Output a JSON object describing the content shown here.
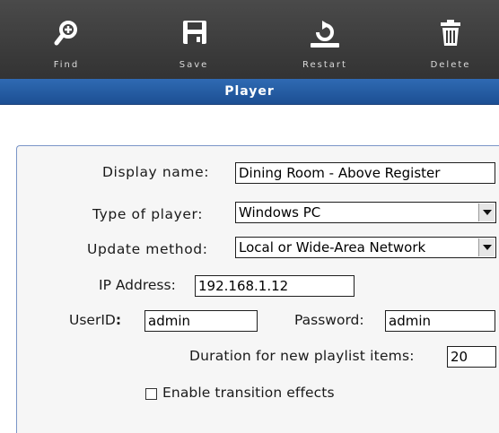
{
  "toolbar": {
    "find_label": "Find",
    "save_label": "Save",
    "restart_label": "Restart",
    "delete_label": "Delete"
  },
  "title": "Player",
  "form": {
    "display_name_label": "Display name:",
    "display_name_value": "Dining Room - Above Register",
    "player_type_label": "Type of player:",
    "player_type_value": "Windows PC",
    "update_method_label": "Update method:",
    "update_method_value": "Local or Wide-Area Network",
    "ip_label": "IP Address:",
    "ip_value": "192.168.1.12",
    "userid_label": "UserID",
    "userid_colon": ":",
    "userid_value": "admin",
    "password_label": "Password:",
    "password_value": "admin",
    "duration_label": "Duration for new playlist items:",
    "duration_value": "20",
    "transition_label": "Enable transition effects",
    "transition_checked": false
  }
}
